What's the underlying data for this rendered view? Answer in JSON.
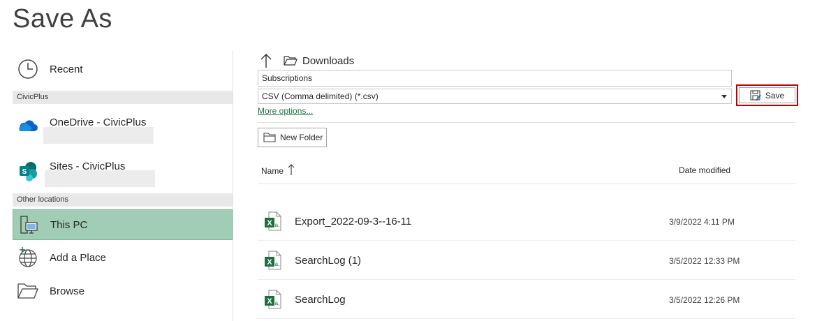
{
  "title": "Save As",
  "nav": {
    "recent": "Recent",
    "section_civicplus": "CivicPlus",
    "onedrive": "OneDrive - CivicPlus",
    "sites": "Sites - CivicPlus",
    "section_other": "Other locations",
    "this_pc": "This PC",
    "add_place": "Add a Place",
    "browse": "Browse"
  },
  "location": {
    "folder": "Downloads"
  },
  "filename": {
    "value": "Subscriptions"
  },
  "filetype": {
    "value": "CSV (Comma delimited) (*.csv)"
  },
  "more_options": "More options...",
  "save_label": "Save",
  "new_folder_label": "New Folder",
  "columns": {
    "name": "Name",
    "date": "Date modified"
  },
  "files": [
    {
      "name": "Export_2022-09-3--16-11",
      "date": "3/9/2022 4:11 PM"
    },
    {
      "name": "SearchLog (1)",
      "date": "3/5/2022 12:33 PM"
    },
    {
      "name": "SearchLog",
      "date": "3/5/2022 12:26 PM"
    }
  ],
  "colors": {
    "accent_green": "#217346",
    "selected_bg": "#a0cdb3",
    "highlight_red": "#c00000"
  }
}
